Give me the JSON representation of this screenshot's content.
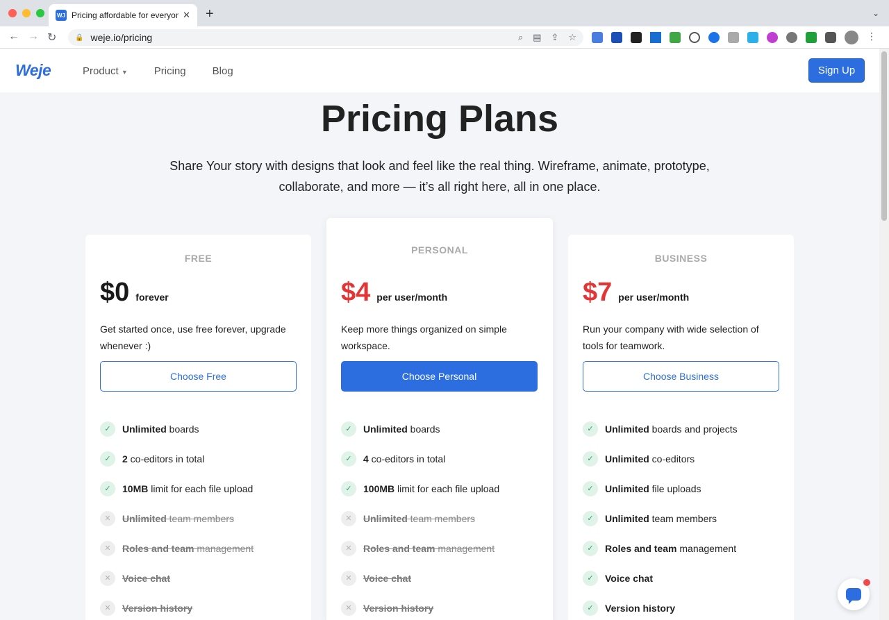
{
  "browser": {
    "tab_title": "Pricing affordable for everyone",
    "tab_favicon": "WJ",
    "url": "weje.io/pricing"
  },
  "site": {
    "logo": "Weje",
    "nav": {
      "product": "Product",
      "pricing": "Pricing",
      "blog": "Blog"
    },
    "signup": "Sign Up"
  },
  "hero": {
    "title": "Pricing Plans",
    "subtitle": "Share Your story with designs that look and feel like the real thing. Wireframe, animate, prototype, collaborate, and more — it’s all right here, all in one place."
  },
  "colors": {
    "accent": "#2c6ee0",
    "price_red": "#e23636",
    "check_green": "#2e9e6a"
  },
  "plans": [
    {
      "name": "FREE",
      "price": "$0",
      "period": "forever",
      "description": "Get started once, use free forever, upgrade whenever :)",
      "button": "Choose Free",
      "features": [
        {
          "bold": "Unlimited",
          "rest": " boards",
          "enabled": true
        },
        {
          "bold": "2",
          "rest": " co-editors in total",
          "enabled": true
        },
        {
          "bold": "10MB",
          "rest": " limit for each file upload",
          "enabled": true
        },
        {
          "bold": "Unlimited",
          "rest": " team members",
          "enabled": false
        },
        {
          "bold": "Roles and team",
          "rest": " management",
          "enabled": false
        },
        {
          "bold": "Voice chat",
          "rest": "",
          "enabled": false
        },
        {
          "bold": "Version history",
          "rest": "",
          "enabled": false
        }
      ]
    },
    {
      "name": "PERSONAL",
      "price": "$4",
      "period": "per user/month",
      "description": "Keep more things organized on simple workspace.",
      "button": "Choose Personal",
      "features": [
        {
          "bold": "Unlimited",
          "rest": " boards",
          "enabled": true
        },
        {
          "bold": "4",
          "rest": " co-editors in total",
          "enabled": true
        },
        {
          "bold": "100MB",
          "rest": " limit for each file upload",
          "enabled": true
        },
        {
          "bold": "Unlimited",
          "rest": " team members",
          "enabled": false
        },
        {
          "bold": "Roles and team",
          "rest": " management",
          "enabled": false
        },
        {
          "bold": "Voice chat",
          "rest": "",
          "enabled": false
        },
        {
          "bold": "Version history",
          "rest": "",
          "enabled": false
        }
      ]
    },
    {
      "name": "BUSINESS",
      "price": "$7",
      "period": "per user/month",
      "description": "Run your company with wide selection of tools for teamwork.",
      "button": "Choose Business",
      "features": [
        {
          "bold": "Unlimited",
          "rest": " boards and projects",
          "enabled": true
        },
        {
          "bold": "Unlimited",
          "rest": " co-editors",
          "enabled": true
        },
        {
          "bold": "Unlimited",
          "rest": " file uploads",
          "enabled": true
        },
        {
          "bold": "Unlimited",
          "rest": " team members",
          "enabled": true
        },
        {
          "bold": "Roles and team",
          "rest": " management",
          "enabled": true
        },
        {
          "bold": "Voice chat",
          "rest": "",
          "enabled": true
        },
        {
          "bold": "Version history",
          "rest": "",
          "enabled": true
        }
      ]
    }
  ]
}
